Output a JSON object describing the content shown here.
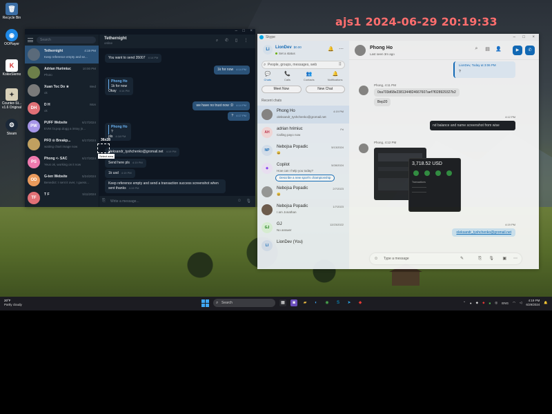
{
  "overlay_timestamp": "ajs1 2024-06-29 20:19:33",
  "desktop_icons": [
    {
      "label": "Recycle Bin",
      "icon": "recycle-bin-icon",
      "glyph": "🗑"
    },
    {
      "label": "OOPlayer",
      "icon": "ooplayer-icon",
      "glyph": "◉"
    },
    {
      "label": "KokieSlemo",
      "icon": "k-app-icon",
      "glyph": "K"
    },
    {
      "label": "Counter-St... v1.6 Original",
      "icon": "counter-strike-icon",
      "glyph": "✦"
    },
    {
      "label": "Steam",
      "icon": "steam-icon",
      "glyph": "⚙"
    }
  ],
  "telegram": {
    "search_placeholder": "Search",
    "chats": [
      {
        "name": "Tethernight",
        "time": "4:19 PM",
        "preview": "Keep reference empty and se...",
        "avatar": "",
        "color": "#5a6a7a",
        "selected": true
      },
      {
        "name": "Adrian Hurimiuc",
        "time": "10:00 PM",
        "preview": "Photo",
        "avatar": "",
        "color": "#6d7f4a"
      },
      {
        "name": "Xuan Toc Do ★",
        "time": "Wed",
        "preview": "ok",
        "avatar": "",
        "color": "#7a7a7a"
      },
      {
        "name": "D H",
        "time": "Mon",
        "preview": "ok",
        "avatar": "DH",
        "color": "#e17076"
      },
      {
        "name": "PUFF Website",
        "time": "6/17/2024",
        "preview": "EVM: bi.pop.dogg a imtoy jn...",
        "avatar": "PW",
        "color": "#a695e7"
      },
      {
        "name": "PFO ⊙ Breakp...",
        "time": "6/17/2024",
        "preview": "waiting chart image now",
        "avatar": "",
        "color": "#c0a060"
      },
      {
        "name": "Phong <- SAC",
        "time": "6/17/2024",
        "preview": "Yeus ok, working on it now",
        "avatar": "PS",
        "color": "#ee7aae"
      },
      {
        "name": "G-ten Website",
        "time": "5/24/2024",
        "preview": "Benedict: I sent it over, I guess...",
        "avatar": "OD",
        "color": "#e99a5c"
      },
      {
        "name": "T F",
        "time": "5/11/2024",
        "preview": "",
        "avatar": "TF",
        "color": "#e17076"
      }
    ],
    "header_title": "Tethernight",
    "header_status": "online",
    "messages": {
      "m1": "You want to send 35007",
      "m1_time": "4:14 PM",
      "m2": "1k for now",
      "m2_time": "4:14 PM",
      "m3_quote_name": "Phong Ho",
      "m3_quote_text": "1k for now",
      "m3": "Okay",
      "m3_time": "4:14 PM",
      "m4": "we have no trust now :D",
      "m4_time": "4:14 PM",
      "m5": "?",
      "m5_time": "4:17 PM",
      "m6_quote_name": "Phong Ho",
      "m6_quote_text": "?",
      "m6": "pls",
      "m6_time": "4:18 PM",
      "m7": "oleksandr_tyshchenko@gromail.net",
      "m7_time": "4:19 PM",
      "m8": "Send here pls",
      "m8_time": "4:19 PM",
      "m9": "1k usd",
      "m9_time": "4:19 PM",
      "m10": "Keep reference empty and send a transaction success screenshot when sent thanks",
      "m10_time": "4:19 PM"
    },
    "composer_placeholder": "Write a message...",
    "selection_size": "36x28",
    "selection_tooltip": "Select area"
  },
  "skype": {
    "title": "Skype",
    "me_name": "LionDev",
    "me_balance": "$0.00",
    "me_status": "Set a status",
    "search_placeholder": "People, groups, messages, web",
    "nav": [
      {
        "label": "Chats",
        "glyph": "💬",
        "active": true
      },
      {
        "label": "Calls",
        "glyph": "📞"
      },
      {
        "label": "Contacts",
        "glyph": "👥"
      },
      {
        "label": "Notifications",
        "glyph": "🔔"
      }
    ],
    "meet_now": "Meet Now",
    "new_chat": "New Chat",
    "recent_label": "Recent chats",
    "chats": [
      {
        "name": "Phong Ho",
        "preview": "oleksandr_tyshchenko@gromail.net",
        "time": "4:19 PM",
        "avatar": "",
        "bg": "#8a8886",
        "fg": "#fff",
        "selected": true
      },
      {
        "name": "adrian hrimiuc",
        "preview": "Calling payo now",
        "time": "Fri",
        "avatar": "AH",
        "bg": "#fcdede",
        "fg": "#c4314b"
      },
      {
        "name": "Nebojsa Popadic",
        "preview": "😀",
        "time": "5/13/2024",
        "avatar": "NP",
        "bg": "#dce6f4",
        "fg": "#0f6cbd"
      },
      {
        "name": "Copilot",
        "preview": "How can I help you today?",
        "time": "5/28/2024",
        "avatar": "◆",
        "bg": "#f3e8fd",
        "fg": "#8a3ffc",
        "pill": "Describe a new sport's championship"
      },
      {
        "name": "Nebojsa Popadic",
        "preview": "😀",
        "time": "2/7/2023",
        "avatar": "",
        "bg": "#9a9a9a",
        "fg": "#fff"
      },
      {
        "name": "Nebojsa Popadic",
        "preview": "I am Jonathan",
        "time": "1/7/2023",
        "avatar": "",
        "bg": "#6e5a4e",
        "fg": "#fff"
      },
      {
        "name": "GJ",
        "preview": "No answer",
        "time": "12/23/2022",
        "avatar": "GJ",
        "bg": "#dff6dd",
        "fg": "#107c10"
      },
      {
        "name": "LionDev (You)",
        "preview": "",
        "time": "",
        "avatar": "LI",
        "bg": "#dce6f4",
        "fg": "#0f6cbd"
      }
    ],
    "conv_name": "Phong Ho",
    "conv_last_seen": "Last seen 3m ago",
    "messages": {
      "top_quote": "LionDev, Today at 3:06 PM",
      "top_q": "?",
      "msg1_who": "Phong, 4:11 PM",
      "msg1_text": "0xa703d68e2381344824667607aef7f028929327b2",
      "msg1_sub": "Bep20",
      "t1": "4:12 PM",
      "out1": "nd balance and name screenshot from wise",
      "msg2_who": "Phong, 4:12 PM",
      "img_amount": "3,718.52 USD",
      "t2": "4:19 PM",
      "out2": "oleksandr_tyshchenko@gromail.net"
    },
    "compose_placeholder": "Type a message"
  },
  "taskbar": {
    "weather_temp": "20°F",
    "weather_desc": "Partly cloudy",
    "search_placeholder": "Search",
    "lang": "ENG",
    "time": "4:19 PM",
    "date": "6/29/2024"
  }
}
